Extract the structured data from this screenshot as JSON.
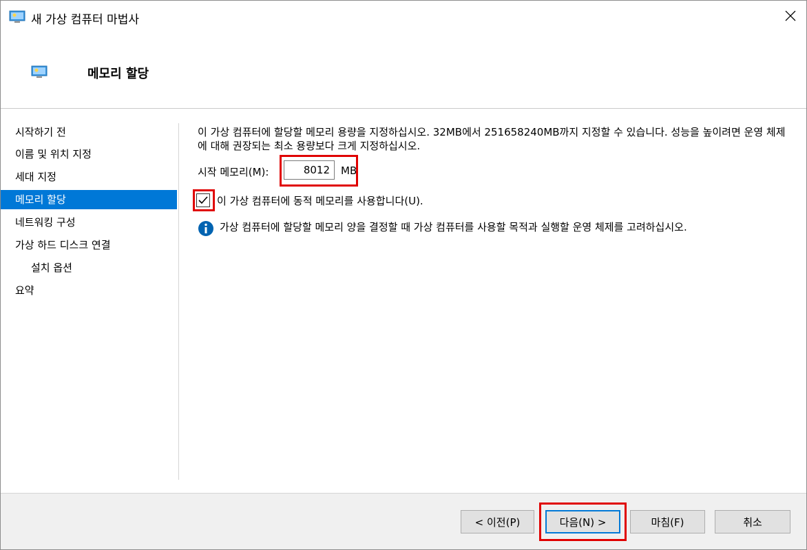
{
  "window": {
    "title": "새 가상 컴퓨터 마법사"
  },
  "header": {
    "title": "메모리 할당"
  },
  "sidebar": {
    "items": [
      {
        "label": "시작하기 전"
      },
      {
        "label": "이름 및 위치 지정"
      },
      {
        "label": "세대 지정"
      },
      {
        "label": "메모리 할당"
      },
      {
        "label": "네트워킹 구성"
      },
      {
        "label": "가상 하드 디스크 연결"
      },
      {
        "label": "설치 옵션"
      },
      {
        "label": "요약"
      }
    ]
  },
  "main": {
    "description": "이 가상 컴퓨터에 할당할 메모리 용량을 지정하십시오. 32MB에서 251658240MB까지 지정할 수 있습니다. 성능을 높이려면 운영 체제에 대해 권장되는 최소 용량보다 크게 지정하십시오.",
    "startup_memory_label": "시작 메모리(M):",
    "startup_memory_value": "8012",
    "startup_memory_unit": "MB",
    "dynamic_memory_label": "이 가상 컴퓨터에 동적 메모리를 사용합니다(U).",
    "dynamic_memory_checked": true,
    "info_text": "가상 컴퓨터에 할당할 메모리 양을 결정할 때 가상 컴퓨터를 사용할 목적과 실행할 운영 체제를 고려하십시오."
  },
  "footer": {
    "prev_label": "< 이전(P)",
    "next_label": "다음(N) >",
    "finish_label": "마침(F)",
    "cancel_label": "취소"
  },
  "colors": {
    "accent": "#0078d7",
    "highlight": "#e00000",
    "footer_bg": "#f0f0f0"
  },
  "icons": {
    "title": "virtual-machine-icon",
    "header": "virtual-machine-icon",
    "close": "close-icon",
    "info": "info-icon",
    "check": "checkmark-icon"
  }
}
